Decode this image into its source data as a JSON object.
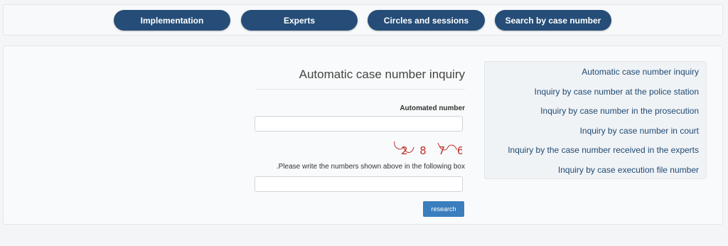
{
  "nav": {
    "items": [
      {
        "label": "Implementation"
      },
      {
        "label": "Experts"
      },
      {
        "label": "Circles and sessions"
      },
      {
        "label": "Search by case number"
      }
    ]
  },
  "sidebar": {
    "links": [
      {
        "label": "Automatic case number inquiry"
      },
      {
        "label": "Inquiry by case number at the police station"
      },
      {
        "label": "Inquiry by case number in the prosecution"
      },
      {
        "label": "Inquiry by case number in court"
      },
      {
        "label": "Inquiry by the case number received in the experts"
      },
      {
        "label": "Inquiry by case execution file number"
      }
    ]
  },
  "form": {
    "title": "Automatic case number inquiry",
    "number_label": "Automated number",
    "number_value": "",
    "captcha_text": "2 8 7 6",
    "hint": ".Please write the numbers shown above in the following box",
    "code_value": "",
    "submit_label": "research"
  },
  "colors": {
    "nav_button": "#254d78",
    "submit_button": "#3a7ebd",
    "link": "#1f4a73",
    "captcha": "#c0302a"
  }
}
